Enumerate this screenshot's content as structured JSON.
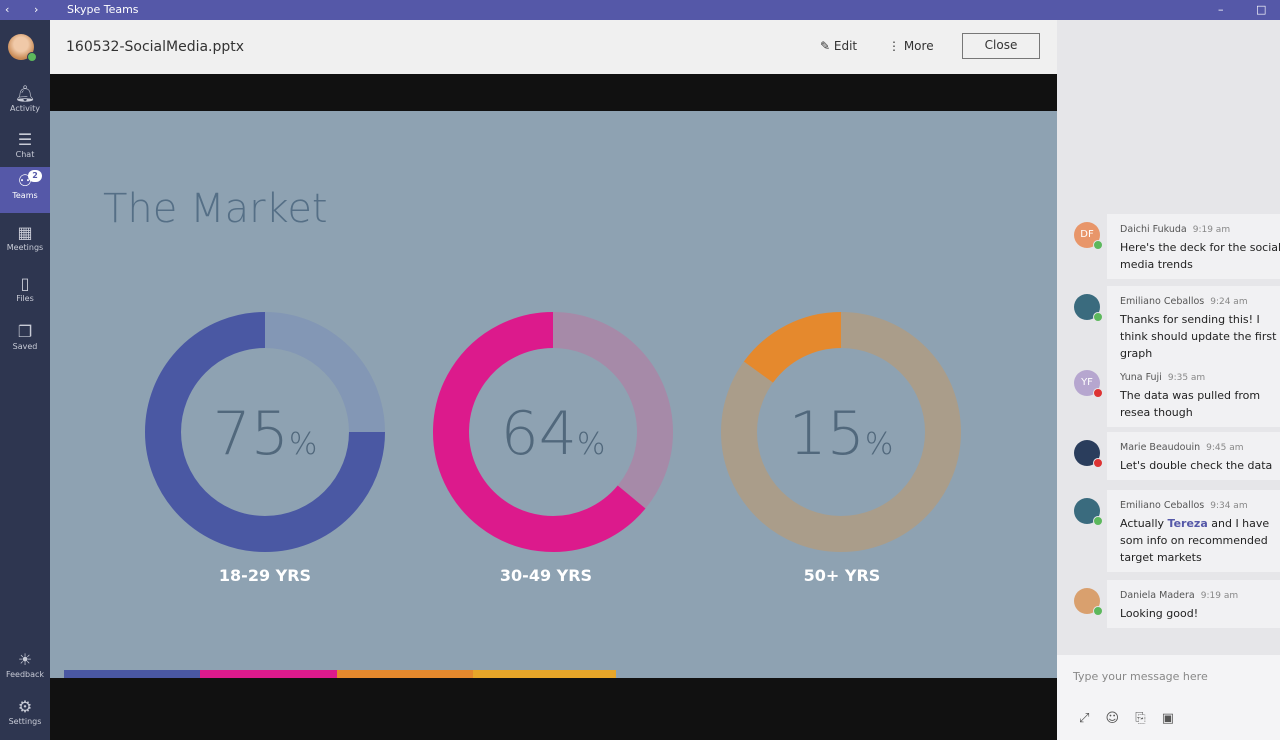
{
  "app": {
    "title": "Skype Teams"
  },
  "rail": {
    "items": [
      {
        "label": "Activity",
        "icon": "bell-icon"
      },
      {
        "label": "Chat",
        "icon": "chat-icon"
      },
      {
        "label": "Teams",
        "icon": "teams-icon",
        "badge": "2"
      },
      {
        "label": "Meetings",
        "icon": "calendar-icon"
      },
      {
        "label": "Files",
        "icon": "file-icon"
      },
      {
        "label": "Saved",
        "icon": "bookmark-icon"
      }
    ],
    "bottom": [
      {
        "label": "Feedback",
        "icon": "lightbulb-icon"
      },
      {
        "label": "Settings",
        "icon": "gear-icon"
      }
    ]
  },
  "header": {
    "filename": "160532-SocialMedia.pptx",
    "edit": "Edit",
    "more": "More",
    "close": "Close"
  },
  "slide": {
    "title": "The Market"
  },
  "chart_data": {
    "type": "pie",
    "title": "The Market",
    "donuts": [
      {
        "label": "18-29 YRS",
        "value": 75,
        "display": "75",
        "unit": "%",
        "color": "#4a58a3",
        "track": "#8397b5"
      },
      {
        "label": "30-49 YRS",
        "value": 64,
        "display": "64",
        "unit": "%",
        "color": "#dc1a8c",
        "track": "#a68aa8"
      },
      {
        "label": "50+ YRS",
        "value": 15,
        "display": "15",
        "unit": "%",
        "color": "#e5892d",
        "track": "#aa9d8a"
      }
    ],
    "bar_colors": [
      "#4a58a3",
      "#dc1a8c",
      "#e5892d",
      "#e7a629"
    ]
  },
  "chat": {
    "messages": [
      {
        "name": "Daichi Fukuda",
        "time": "9:19 am",
        "text": "Here's the deck for the social media trends",
        "initials": "DF",
        "avatar_color": "#e8966a",
        "status": "online"
      },
      {
        "name": "Emiliano Ceballos",
        "time": "9:24 am",
        "text": "Thanks for sending this! I think should update the first graph",
        "initials": "",
        "avatar_color": "#3a6b7e",
        "status": "online"
      },
      {
        "name": "Yuna Fuji",
        "time": "9:35 am",
        "text": "The data was pulled from resea though",
        "initials": "YF",
        "avatar_color": "#b6a6cf",
        "status": "busy"
      },
      {
        "name": "Marie Beaudouin",
        "time": "9:45 am",
        "text": "Let's double check the data",
        "initials": "",
        "avatar_color": "#2a3d5c",
        "status": "busy"
      },
      {
        "name": "Emiliano Ceballos",
        "time": "9:34 am",
        "text_pre": "Actually ",
        "mention": "Tereza",
        "text_post": " and I have som info on recommended target markets",
        "initials": "",
        "avatar_color": "#3a6b7e",
        "status": "online"
      },
      {
        "name": "Daniela Madera",
        "time": "9:19 am",
        "text": "Looking good!",
        "initials": "",
        "avatar_color": "#d9a06e",
        "status": "online"
      }
    ],
    "compose_placeholder": "Type your message here"
  }
}
